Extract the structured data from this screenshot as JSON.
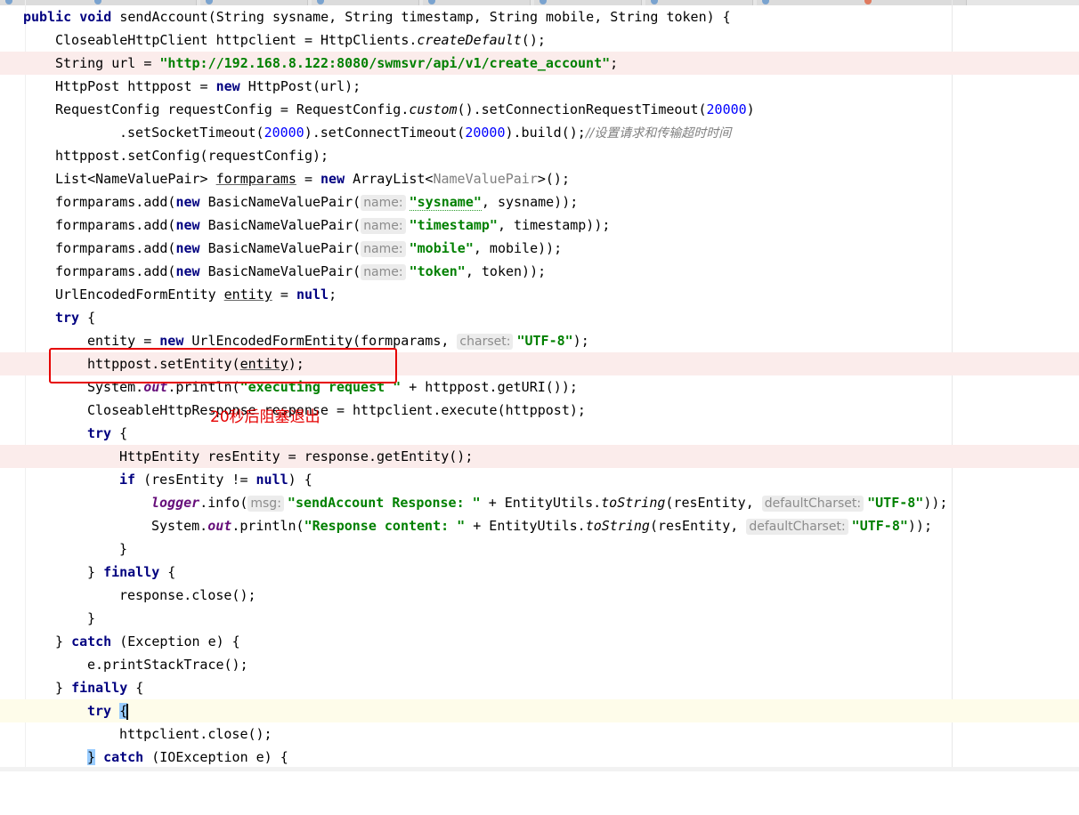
{
  "annotation": {
    "label": "20秒后阻塞退出"
  },
  "code": {
    "l1": {
      "kw_public": "public",
      "kw_void": "void",
      "rest": " sendAccount(String sysname, String timestamp, String mobile, String token) {"
    },
    "l2": {
      "a": "CloseableHttpClient httpclient = HttpClients.",
      "b": "createDefault",
      "c": "();"
    },
    "l3": {
      "a": "String url = ",
      "str": "\"http://192.168.8.122:8080/swmsvr/api/v1/create_account\"",
      "c": ";"
    },
    "l4": {
      "a": "HttpPost httppost = ",
      "kw": "new",
      "c": " HttpPost(url);"
    },
    "l5": {
      "a": "RequestConfig requestConfig = RequestConfig.",
      "b": "custom",
      "c": "().setConnectionRequestTimeout(",
      "n": "20000",
      "d": ")"
    },
    "l6": {
      "a": ".setSocketTimeout(",
      "n1": "20000",
      "b": ").setConnectTimeout(",
      "n2": "20000",
      "c": ").build();",
      "cmt": "//设置请求和传输超时时间"
    },
    "l7": {
      "a": "httppost.setConfig(requestConfig);"
    },
    "l8": {
      "a": "List<NameValuePair> ",
      "b": "formparams",
      "c": " = ",
      "kw": "new",
      "d": " ArrayList<",
      "gen": "NameValuePair",
      "e": ">();"
    },
    "l9": {
      "a": "formparams.add(",
      "kw": "new",
      "b": " BasicNameValuePair(",
      "hint": "name:",
      "str": "\"sysname\"",
      "c": ", sysname));"
    },
    "l10": {
      "a": "formparams.add(",
      "kw": "new",
      "b": " BasicNameValuePair(",
      "hint": "name:",
      "str": "\"timestamp\"",
      "c": ", timestamp));"
    },
    "l11": {
      "a": "formparams.add(",
      "kw": "new",
      "b": " BasicNameValuePair(",
      "hint": "name:",
      "str": "\"mobile\"",
      "c": ", mobile));"
    },
    "l12": {
      "a": "formparams.add(",
      "kw": "new",
      "b": " BasicNameValuePair(",
      "hint": "name:",
      "str": "\"token\"",
      "c": ", token));"
    },
    "l13": {
      "a": "UrlEncodedFormEntity ",
      "b": "entity",
      "c": " = ",
      "kw": "null",
      "d": ";"
    },
    "l14": {
      "kw": "try",
      "a": " {"
    },
    "l15": {
      "a": "entity = ",
      "kw": "new",
      "b": " UrlEncodedFormEntity(formparams, ",
      "hint": "charset:",
      "str": "\"UTF-8\"",
      "c": ");"
    },
    "l16": {
      "a": "httppost.setEntity(",
      "b": "entity",
      "c": ");"
    },
    "l17": {
      "a": "System.",
      "f": "out",
      "b": ".println(",
      "str": "\"executing request \"",
      "c": " + httppost.getURI());"
    },
    "l18": {
      "a": "CloseableHttpResponse response = httpclient.execute(httppost);"
    },
    "l19": {
      "kw": "try",
      "a": " {"
    },
    "l20": {
      "a": "HttpEntity resEntity = response.getEntity();"
    },
    "l21": {
      "kw": "if",
      "a": " (resEntity != ",
      "kw2": "null",
      "b": ") {"
    },
    "l22": {
      "f": "logger",
      "a": ".info(",
      "hint": "msg:",
      "str": "\"sendAccount Response: \"",
      "b": " + EntityUtils.",
      "it": "toString",
      "c": "(resEntity, ",
      "hint2": "defaultCharset:",
      "str2": "\"UTF-8\"",
      "d": "));"
    },
    "l23": {
      "a": "System.",
      "f": "out",
      "b": ".println(",
      "str": "\"Response content: \"",
      "c": " + EntityUtils.",
      "it": "toString",
      "d": "(resEntity, ",
      "hint": "defaultCharset:",
      "str2": "\"UTF-8\"",
      "e": "));"
    },
    "l24": {
      "a": "}"
    },
    "l25": {
      "a": "} ",
      "kw": "finally",
      "b": " {"
    },
    "l26": {
      "a": "response.close();"
    },
    "l27": {
      "a": "}"
    },
    "l28": {
      "a": "} ",
      "kw": "catch",
      "b": " (Exception e) {"
    },
    "l29": {
      "a": "e.printStackTrace();"
    },
    "l30": {
      "a": "} ",
      "kw": "finally",
      "b": " {"
    },
    "l31": {
      "kw": "try",
      "a": " ",
      "brace": "{"
    },
    "l32": {
      "a": "httpclient.close();"
    },
    "l33": {
      "a": "} ",
      "kw": "catch",
      "b": " (IOException e) {"
    }
  }
}
